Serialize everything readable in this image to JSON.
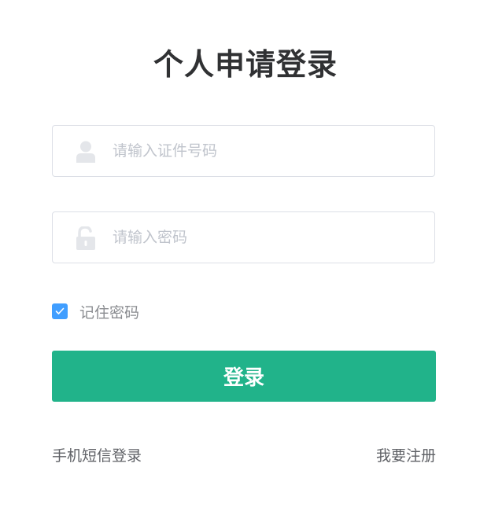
{
  "page": {
    "title": "个人申请登录"
  },
  "form": {
    "id_field": {
      "placeholder": "请输入证件号码",
      "value": "",
      "icon": "user-icon"
    },
    "password_field": {
      "placeholder": "请输入密码",
      "value": "",
      "icon": "lock-icon"
    },
    "remember": {
      "label": "记住密码",
      "checked": true
    },
    "login_button_label": "登录"
  },
  "footer": {
    "sms_login_label": "手机短信登录",
    "register_label": "我要注册"
  },
  "colors": {
    "accent": "#21b38a",
    "checkbox": "#409eff",
    "title": "#303133"
  }
}
